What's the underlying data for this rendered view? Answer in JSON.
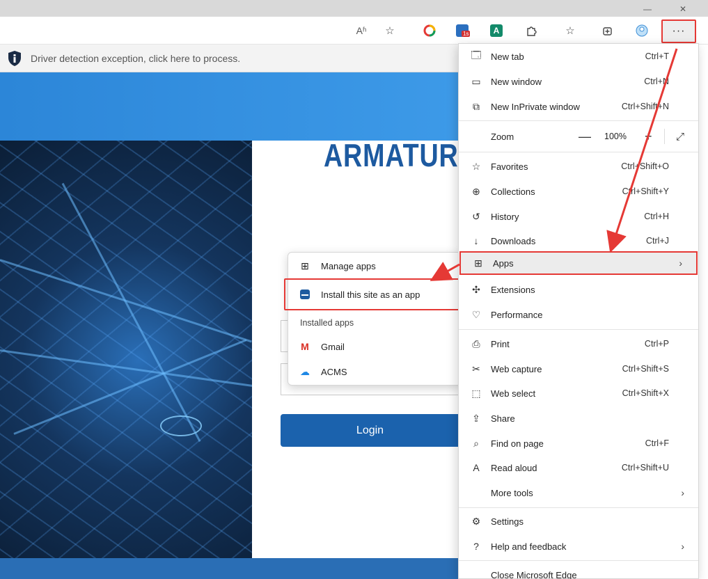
{
  "window_controls": {
    "minimize": "—",
    "close": "✕"
  },
  "toolbar": {
    "read_aloud": "Aʱ",
    "extension_badge": "1s",
    "extension_letter": "A",
    "more_label": "···"
  },
  "notice": {
    "text": "Driver detection exception, click here to process."
  },
  "page": {
    "brand": "ARMATUR",
    "login_label": "Login"
  },
  "apps_submenu": {
    "manage": "Manage apps",
    "install": "Install this site as an app",
    "installed_header": "Installed apps",
    "installed": [
      {
        "label": "Gmail",
        "icon": "gmail-icon"
      },
      {
        "label": "ACMS",
        "icon": "acms-cloud-icon"
      }
    ]
  },
  "menu": {
    "new_tab": {
      "label": "New tab",
      "shortcut": "Ctrl+T"
    },
    "new_window": {
      "label": "New window",
      "shortcut": "Ctrl+N"
    },
    "new_inprivate": {
      "label": "New InPrivate window",
      "shortcut": "Ctrl+Shift+N"
    },
    "zoom": {
      "label": "Zoom",
      "value": "100%",
      "minus": "—",
      "plus": "+"
    },
    "favorites": {
      "label": "Favorites",
      "shortcut": "Ctrl+Shift+O"
    },
    "collections": {
      "label": "Collections",
      "shortcut": "Ctrl+Shift+Y"
    },
    "history": {
      "label": "History",
      "shortcut": "Ctrl+H"
    },
    "downloads": {
      "label": "Downloads",
      "shortcut": "Ctrl+J"
    },
    "apps": {
      "label": "Apps"
    },
    "extensions": {
      "label": "Extensions"
    },
    "performance": {
      "label": "Performance"
    },
    "print": {
      "label": "Print",
      "shortcut": "Ctrl+P"
    },
    "web_capture": {
      "label": "Web capture",
      "shortcut": "Ctrl+Shift+S"
    },
    "web_select": {
      "label": "Web select",
      "shortcut": "Ctrl+Shift+X"
    },
    "share": {
      "label": "Share"
    },
    "find": {
      "label": "Find on page",
      "shortcut": "Ctrl+F"
    },
    "read_aloud": {
      "label": "Read aloud",
      "shortcut": "Ctrl+Shift+U"
    },
    "more_tools": {
      "label": "More tools"
    },
    "settings": {
      "label": "Settings"
    },
    "help": {
      "label": "Help and feedback"
    },
    "close_edge": {
      "label": "Close Microsoft Edge"
    }
  },
  "colors": {
    "highlight": "#e53935",
    "brand": "#1d5aa0",
    "login_button": "#1b62ad"
  }
}
